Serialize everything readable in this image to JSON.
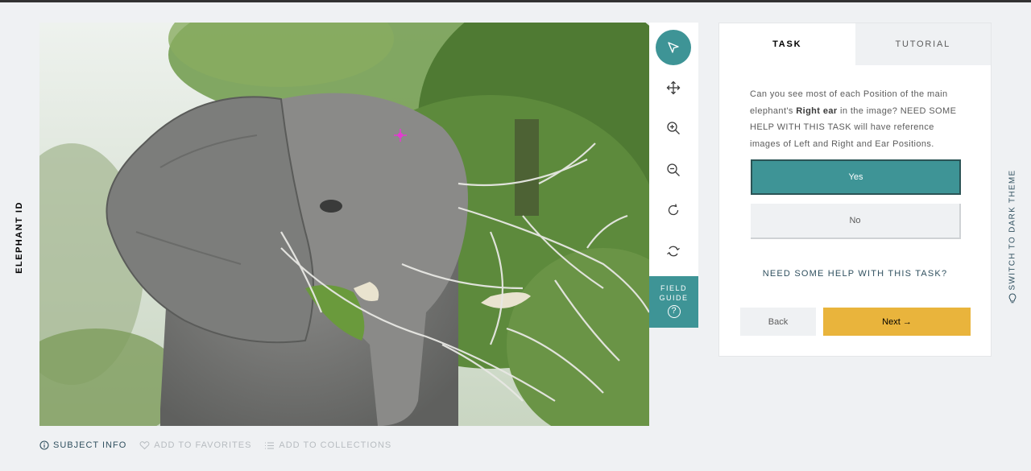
{
  "project": {
    "title": "ELEPHANT ID"
  },
  "subject": {
    "image_description": "",
    "marker_color": "#e23bd0"
  },
  "tools": [
    {
      "name": "annotate",
      "icon": "pointer-arrow-icon",
      "active": true
    },
    {
      "name": "move",
      "icon": "move-arrows-icon"
    },
    {
      "name": "zoom-in",
      "icon": "zoom-in-icon"
    },
    {
      "name": "zoom-out",
      "icon": "zoom-out-icon"
    },
    {
      "name": "rotate",
      "icon": "rotate-icon"
    },
    {
      "name": "reset",
      "icon": "reset-icon"
    }
  ],
  "field_guide": {
    "line1": "FIELD",
    "line2": "GUIDE",
    "icon_glyph": "?"
  },
  "meta": {
    "subject_info": "SUBJECT INFO",
    "add_favorites": "ADD TO FAVORITES",
    "add_collections": "ADD TO COLLECTIONS"
  },
  "panel": {
    "tabs": {
      "task": "TASK",
      "tutorial": "TUTORIAL"
    },
    "question": {
      "before": "Can you see most of each Position of the main elephant's ",
      "bold": "Right ear",
      "after": " in the image? NEED SOME HELP WITH THIS TASK will have reference images of Left and Right and Ear Positions."
    },
    "answers": {
      "yes": "Yes",
      "no": "No"
    },
    "help_link": "NEED SOME HELP WITH THIS TASK?",
    "back": "Back",
    "next": "Next →"
  },
  "theme_switch": "SWITCH TO DARK THEME",
  "colors": {
    "teal": "#3e9496",
    "teal_dark": "#2b5456",
    "gold": "#e9b43c",
    "navy_text": "#30505f",
    "page_bg": "#eff1f3"
  }
}
